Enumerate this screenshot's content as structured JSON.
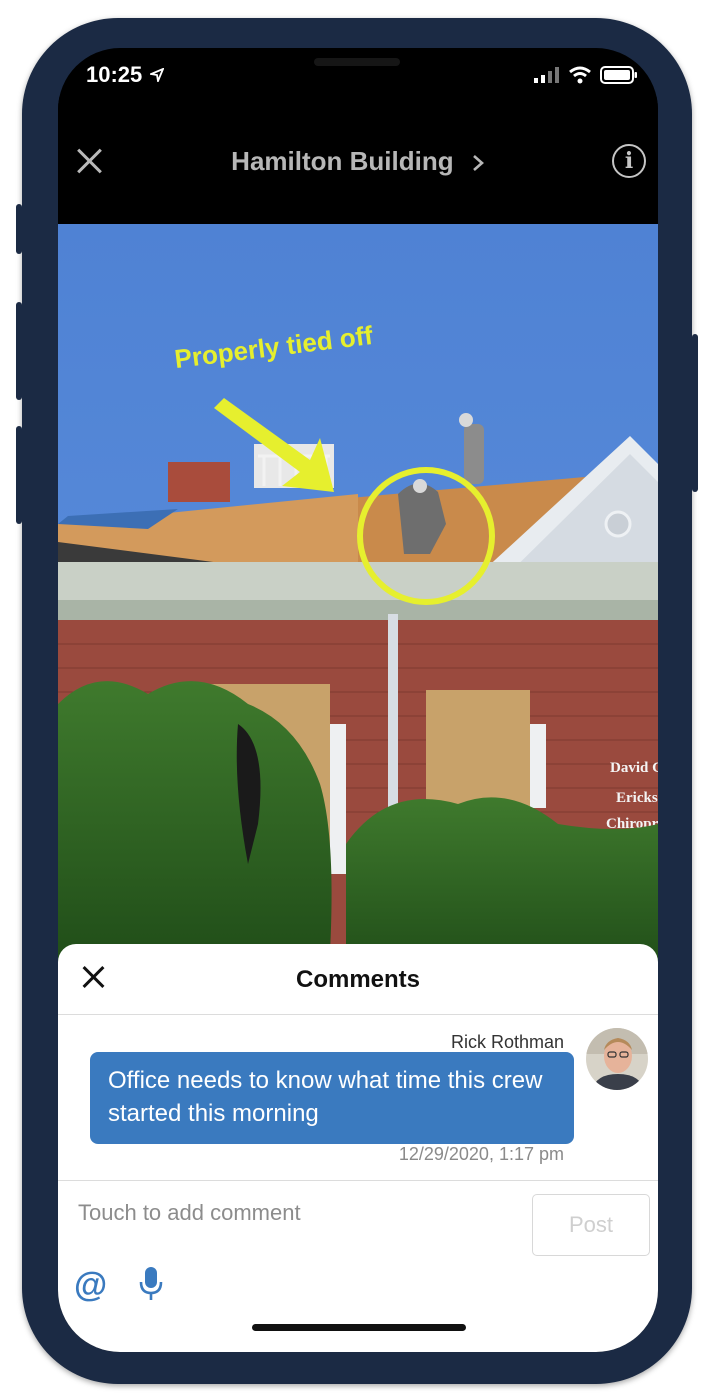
{
  "status_bar": {
    "time": "10:25"
  },
  "header": {
    "title": "Hamilton Building"
  },
  "photo": {
    "annotation_label": "Properly tied off"
  },
  "comments": {
    "title": "Comments",
    "author": "Rick Rothman",
    "message": "Office needs to know what time this crew started this morning",
    "timestamp": "12/29/2020, 1:17 pm",
    "input_placeholder": "Touch to add comment",
    "post_label": "Post"
  },
  "colors": {
    "accent": "#3a7abf",
    "annotation": "#e6ef2e",
    "frame": "#1b2a44"
  },
  "icons": [
    "close-icon",
    "chevron-right-icon",
    "info-icon",
    "location-arrow-icon",
    "signal-icon",
    "wifi-icon",
    "battery-icon",
    "at-icon",
    "microphone-icon"
  ]
}
